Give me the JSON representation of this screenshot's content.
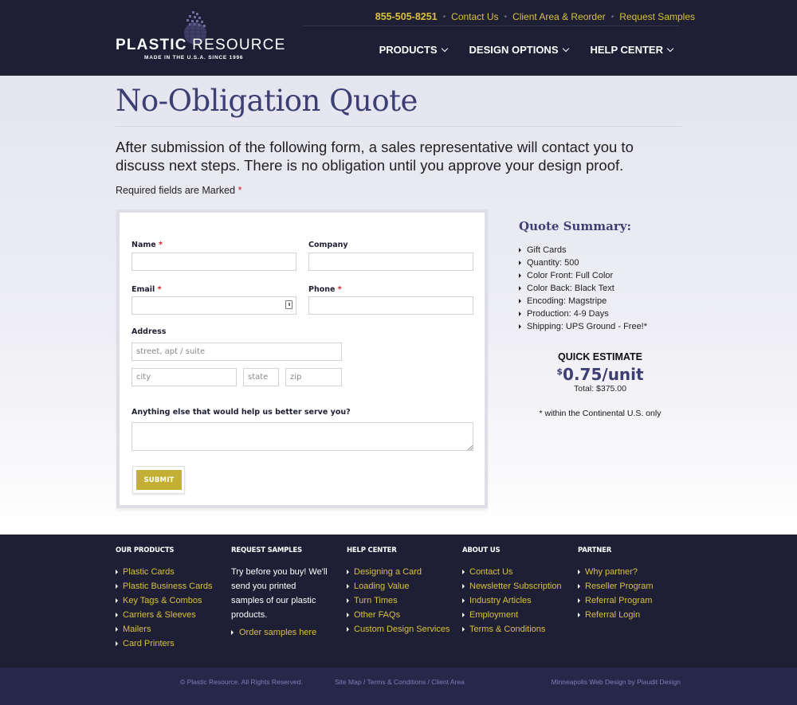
{
  "header": {
    "logo": {
      "name_bold": "PLASTIC",
      "name_light": "RESOURCE",
      "tagline": "MADE IN THE U.S.A. SINCE 1996"
    },
    "utility": {
      "phone": "855-505-8251",
      "links": [
        "Contact Us",
        "Client Area & Reorder",
        "Request Samples"
      ],
      "separator": "•"
    },
    "nav": [
      {
        "label": "PRODUCTS"
      },
      {
        "label": "DESIGN OPTIONS"
      },
      {
        "label": "HELP CENTER"
      }
    ],
    "colors": {
      "background": "#1e1f35",
      "accent": "#d8c13a"
    }
  },
  "page": {
    "title": "No-Obligation Quote",
    "intro": "After submission of the following form, a sales representative will contact you to discuss next steps. There is no obligation until you approve your design proof.",
    "required_note": "Required fields are Marked",
    "required_mark": "*"
  },
  "form": {
    "name": {
      "label": "Name",
      "required": "*",
      "value": ""
    },
    "company": {
      "label": "Company",
      "value": ""
    },
    "email": {
      "label": "Email",
      "required": "*",
      "value": ""
    },
    "phone": {
      "label": "Phone",
      "required": "*",
      "value": ""
    },
    "address": {
      "label": "Address",
      "street_placeholder": "street, apt / suite",
      "city_placeholder": "city",
      "state_placeholder": "state",
      "zip_placeholder": "zip"
    },
    "comments": {
      "label": "Anything else that would help us better serve you?",
      "value": ""
    },
    "submit_label": "SUBMIT",
    "submit_color": "#c3af33"
  },
  "summary": {
    "title": "Quote Summary:",
    "items": [
      "Gift Cards",
      "Quantity: 500",
      "Color Front: Full Color",
      "Color Back: Black Text",
      "Encoding: Magstripe",
      "Production: 4-9 Days",
      "Shipping: UPS Ground - Free!*"
    ],
    "estimate": {
      "label": "QUICK ESTIMATE",
      "currency": "$",
      "price": "0.75/unit",
      "total": "Total: $375.00"
    },
    "note": "* within the Continental U.S. only"
  },
  "footer": {
    "columns": [
      {
        "heading": "OUR PRODUCTS",
        "links": [
          "Plastic Cards",
          "Plastic Business Cards",
          "Key Tags & Combos",
          "Carriers & Sleeves",
          "Mailers",
          "Card Printers"
        ]
      },
      {
        "heading": "REQUEST SAMPLES",
        "text": "Try before you buy! We'll send you printed samples of our plastic products.",
        "links": [
          "Order samples here"
        ]
      },
      {
        "heading": "HELP CENTER",
        "links": [
          "Designing a Card",
          "Loading Value",
          "Turn Times",
          "Other FAQs",
          "Custom Design Services"
        ]
      },
      {
        "heading": "ABOUT US",
        "links": [
          "Contact Us",
          "Newsletter Subscription",
          "Industry Articles",
          "Employment",
          "Terms & Conditions"
        ]
      },
      {
        "heading": "PARTNER",
        "links": [
          "Why partner?",
          "Reseller Program",
          "Referral Program",
          "Referral Login"
        ]
      }
    ],
    "bottom": {
      "copyright": "© Plastic Resource. All Rights Reserved.",
      "links": "Site Map / Terms & Conditions / Client Area",
      "credit": "Minneapolis Web Design by Plaudit Design"
    }
  }
}
